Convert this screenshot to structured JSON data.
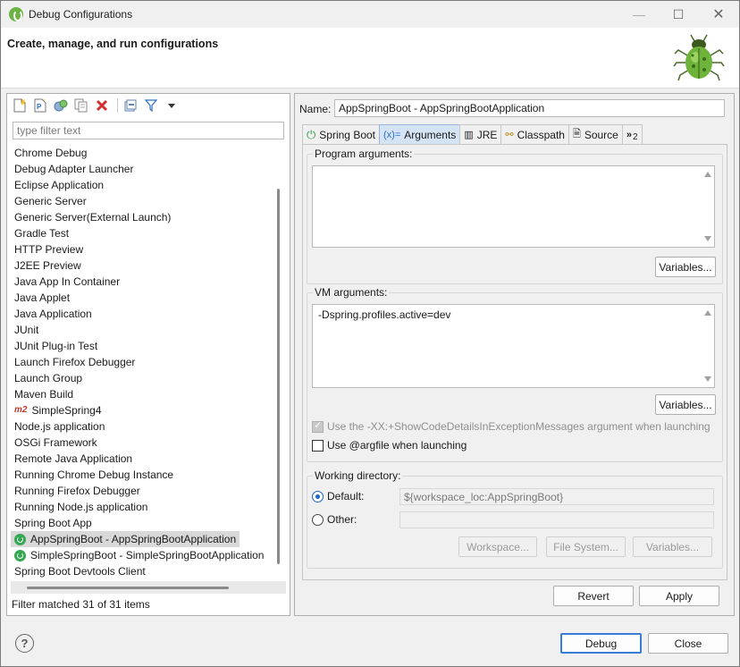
{
  "window": {
    "title": "Debug Configurations",
    "min_glyph": "—",
    "max_glyph": "☐",
    "close_glyph": "✕"
  },
  "banner": {
    "heading": "Create, manage, and run configurations"
  },
  "left": {
    "toolbar_icons": [
      "new-config-icon",
      "new-prototype-icon",
      "export-icon",
      "duplicate-icon",
      "delete-icon",
      "collapse-all-icon",
      "filter-icon",
      "view-menu-icon"
    ],
    "filter_placeholder": "type filter text",
    "items": [
      {
        "label": "Chrome Debug",
        "icon": "none"
      },
      {
        "label": "Debug Adapter Launcher",
        "icon": "none"
      },
      {
        "label": "Eclipse Application",
        "icon": "none"
      },
      {
        "label": "Generic Server",
        "icon": "none"
      },
      {
        "label": "Generic Server(External Launch)",
        "icon": "none"
      },
      {
        "label": "Gradle Test",
        "icon": "none"
      },
      {
        "label": "HTTP Preview",
        "icon": "none"
      },
      {
        "label": "J2EE Preview",
        "icon": "none"
      },
      {
        "label": "Java App In Container",
        "icon": "none"
      },
      {
        "label": "Java Applet",
        "icon": "none"
      },
      {
        "label": "Java Application",
        "icon": "none"
      },
      {
        "label": "JUnit",
        "icon": "none"
      },
      {
        "label": "JUnit Plug-in Test",
        "icon": "none"
      },
      {
        "label": "Launch Firefox Debugger",
        "icon": "none"
      },
      {
        "label": "Launch Group",
        "icon": "none"
      },
      {
        "label": "Maven Build",
        "icon": "none"
      },
      {
        "label": "SimpleSpring4",
        "icon": "m2"
      },
      {
        "label": "Node.js application",
        "icon": "none"
      },
      {
        "label": "OSGi Framework",
        "icon": "none"
      },
      {
        "label": "Remote Java Application",
        "icon": "none"
      },
      {
        "label": "Running Chrome Debug Instance",
        "icon": "none"
      },
      {
        "label": "Running Firefox Debugger",
        "icon": "none"
      },
      {
        "label": "Running Node.js application",
        "icon": "none"
      },
      {
        "label": "Spring Boot App",
        "icon": "none"
      },
      {
        "label": "AppSpringBoot - AppSpringBootApplication",
        "icon": "spring",
        "selected": true
      },
      {
        "label": "SimpleSpringBoot - SimpleSpringBootApplication",
        "icon": "spring"
      },
      {
        "label": "Spring Boot Devtools Client",
        "icon": "none"
      }
    ],
    "m2_text": "m2",
    "status": "Filter matched 31 of 31 items"
  },
  "right": {
    "name_label": "Name:",
    "name_value": "AppSpringBoot - AppSpringBootApplication",
    "tabs": [
      {
        "label": "Spring Boot",
        "icon": "spring-icon",
        "glyph": "⏻"
      },
      {
        "label": "Arguments",
        "icon": "arguments-icon",
        "glyph": "(x)=",
        "active": true
      },
      {
        "label": "JRE",
        "icon": "jre-icon",
        "glyph": "▥"
      },
      {
        "label": "Classpath",
        "icon": "classpath-icon",
        "glyph": "⚯"
      },
      {
        "label": "Source",
        "icon": "source-icon",
        "glyph": "🗎"
      },
      {
        "label": "2",
        "icon": "overflow-icon",
        "glyph": "»"
      }
    ],
    "program_args": {
      "label": "Program arguments:",
      "value": "",
      "variables_button": "Variables..."
    },
    "vm_args": {
      "label": "VM arguments:",
      "value": "-Dspring.profiles.active=dev",
      "variables_button": "Variables..."
    },
    "show_code_details": {
      "label": "Use the -XX:+ShowCodeDetailsInExceptionMessages argument when launching",
      "checked": true,
      "disabled": true
    },
    "argfile": {
      "label": "Use @argfile when launching",
      "checked": false
    },
    "working_dir": {
      "label": "Working directory:",
      "default_label": "Default:",
      "default_value": "${workspace_loc:AppSpringBoot}",
      "other_label": "Other:",
      "other_value": "",
      "workspace_button": "Workspace...",
      "filesystem_button": "File System...",
      "variables_button": "Variables..."
    },
    "revert_button": "Revert",
    "apply_button": "Apply"
  },
  "footer": {
    "help_glyph": "?",
    "debug_button": "Debug",
    "close_button": "Close"
  },
  "colors": {
    "accent": "#1a66c9",
    "spring_green": "#34a853",
    "delete_red": "#d32f2f",
    "tab_active": "#d5e4f5"
  }
}
